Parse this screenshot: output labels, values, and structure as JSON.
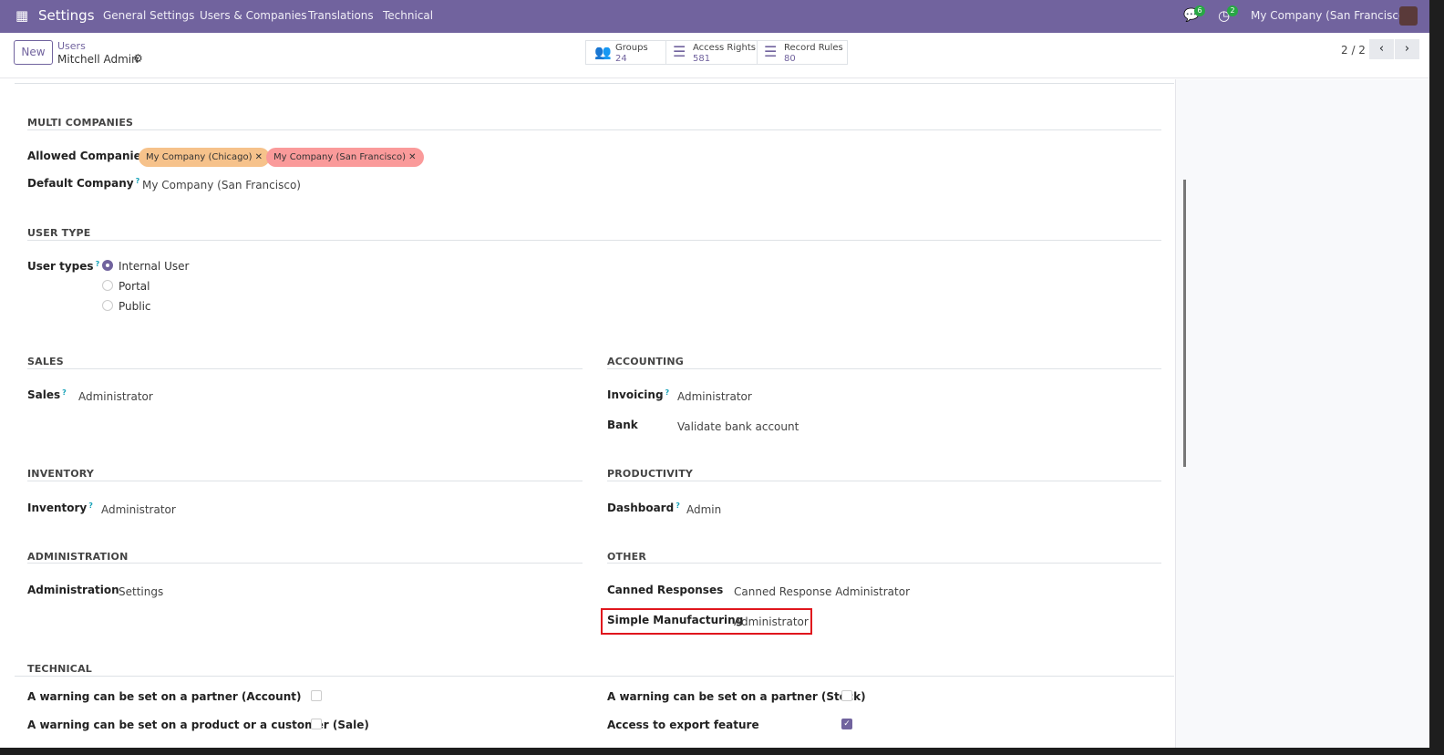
{
  "nav": {
    "app": "Settings",
    "menus": [
      "General Settings",
      "Users & Companies",
      "Translations",
      "Technical"
    ],
    "chat_count": "6",
    "activity_count": "2",
    "company": "My Company (San Francisco)"
  },
  "control": {
    "new_label": "New",
    "breadcrumb_parent": "Users",
    "record_name": "Mitchell Admin",
    "stats": [
      {
        "label": "Groups",
        "value": "24"
      },
      {
        "label": "Access Rights",
        "value": "581"
      },
      {
        "label": "Record Rules",
        "value": "80"
      }
    ],
    "pager": "2 / 2"
  },
  "multi": {
    "title": "MULTI COMPANIES",
    "allowed_label": "Allowed Companies",
    "tags": [
      "My Company (Chicago)",
      "My Company (San Francisco)"
    ],
    "default_label": "Default Company",
    "default_value": "My Company (San Francisco)"
  },
  "user_type": {
    "title": "USER TYPE",
    "label": "User types",
    "options": [
      "Internal User",
      "Portal",
      "Public"
    ],
    "selected": "Internal User"
  },
  "sales": {
    "title": "SALES",
    "label": "Sales",
    "value": "Administrator"
  },
  "accounting": {
    "title": "ACCOUNTING",
    "invoicing_label": "Invoicing",
    "invoicing_value": "Administrator",
    "bank_label": "Bank",
    "bank_value": "Validate bank account"
  },
  "inventory": {
    "title": "INVENTORY",
    "label": "Inventory",
    "value": "Administrator"
  },
  "productivity": {
    "title": "PRODUCTIVITY",
    "label": "Dashboard",
    "value": "Admin"
  },
  "administration": {
    "title": "ADMINISTRATION",
    "label": "Administration",
    "value": "Settings"
  },
  "other": {
    "title": "OTHER",
    "canned_label": "Canned Responses",
    "canned_value": "Canned Response Administrator",
    "mfg_label": "Simple Manufacturing",
    "mfg_value": "Administrator"
  },
  "technical": {
    "title": "TECHNICAL",
    "items": [
      {
        "label": "A warning can be set on a partner (Account)",
        "checked": false
      },
      {
        "label": "A warning can be set on a partner (Stock)",
        "checked": false
      },
      {
        "label": "A warning can be set on a product or a customer (Sale)",
        "checked": false
      },
      {
        "label": "Access to export feature",
        "checked": true
      }
    ]
  },
  "colors": {
    "brand": "#71639e",
    "tag_chicago": "#f6c28b",
    "tag_sf": "#fa9a9a",
    "highlight": "#e0161d"
  }
}
